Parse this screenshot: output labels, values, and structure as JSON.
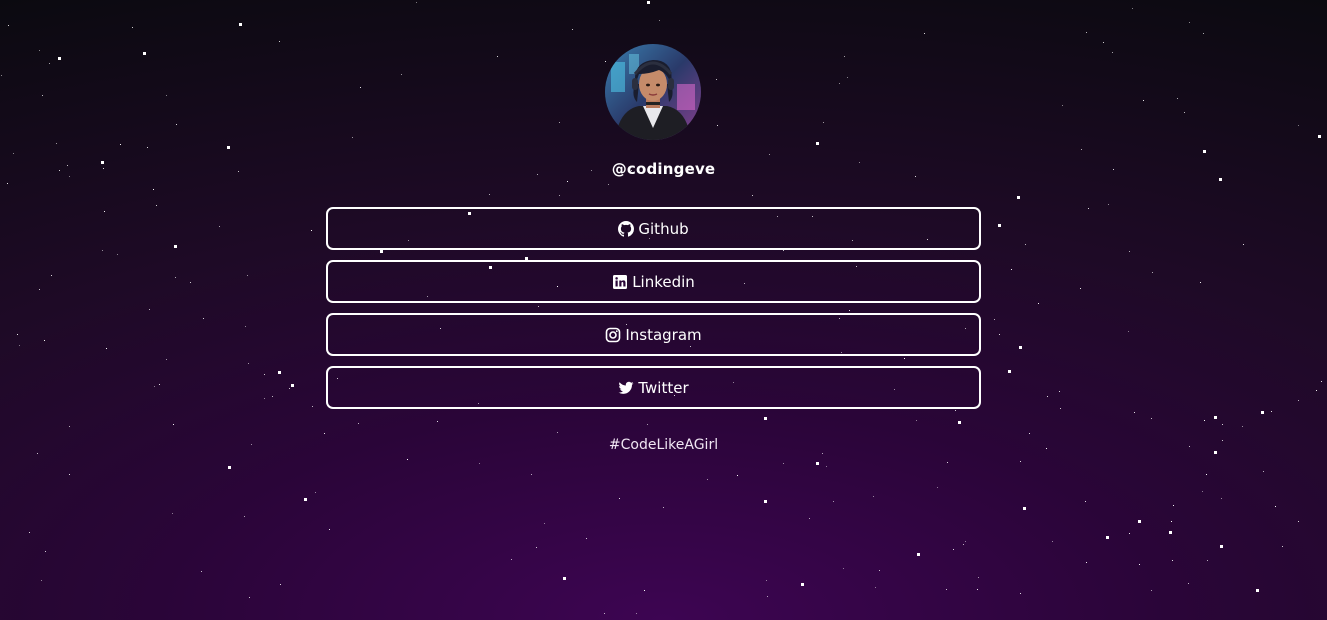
{
  "profile": {
    "username": "@codingeve",
    "avatar_alt": "profile-avatar"
  },
  "links": [
    {
      "label": "Github",
      "icon": "github-icon"
    },
    {
      "label": "Linkedin",
      "icon": "linkedin-icon"
    },
    {
      "label": "Instagram",
      "icon": "instagram-icon"
    },
    {
      "label": "Twitter",
      "icon": "twitter-icon"
    }
  ],
  "footer": {
    "hashtag": "#CodeLikeAGirl"
  },
  "colors": {
    "background_center": "#3d0552",
    "background_edge": "#0b0a10",
    "button_border": "#ffffff",
    "text": "#ffffff"
  }
}
